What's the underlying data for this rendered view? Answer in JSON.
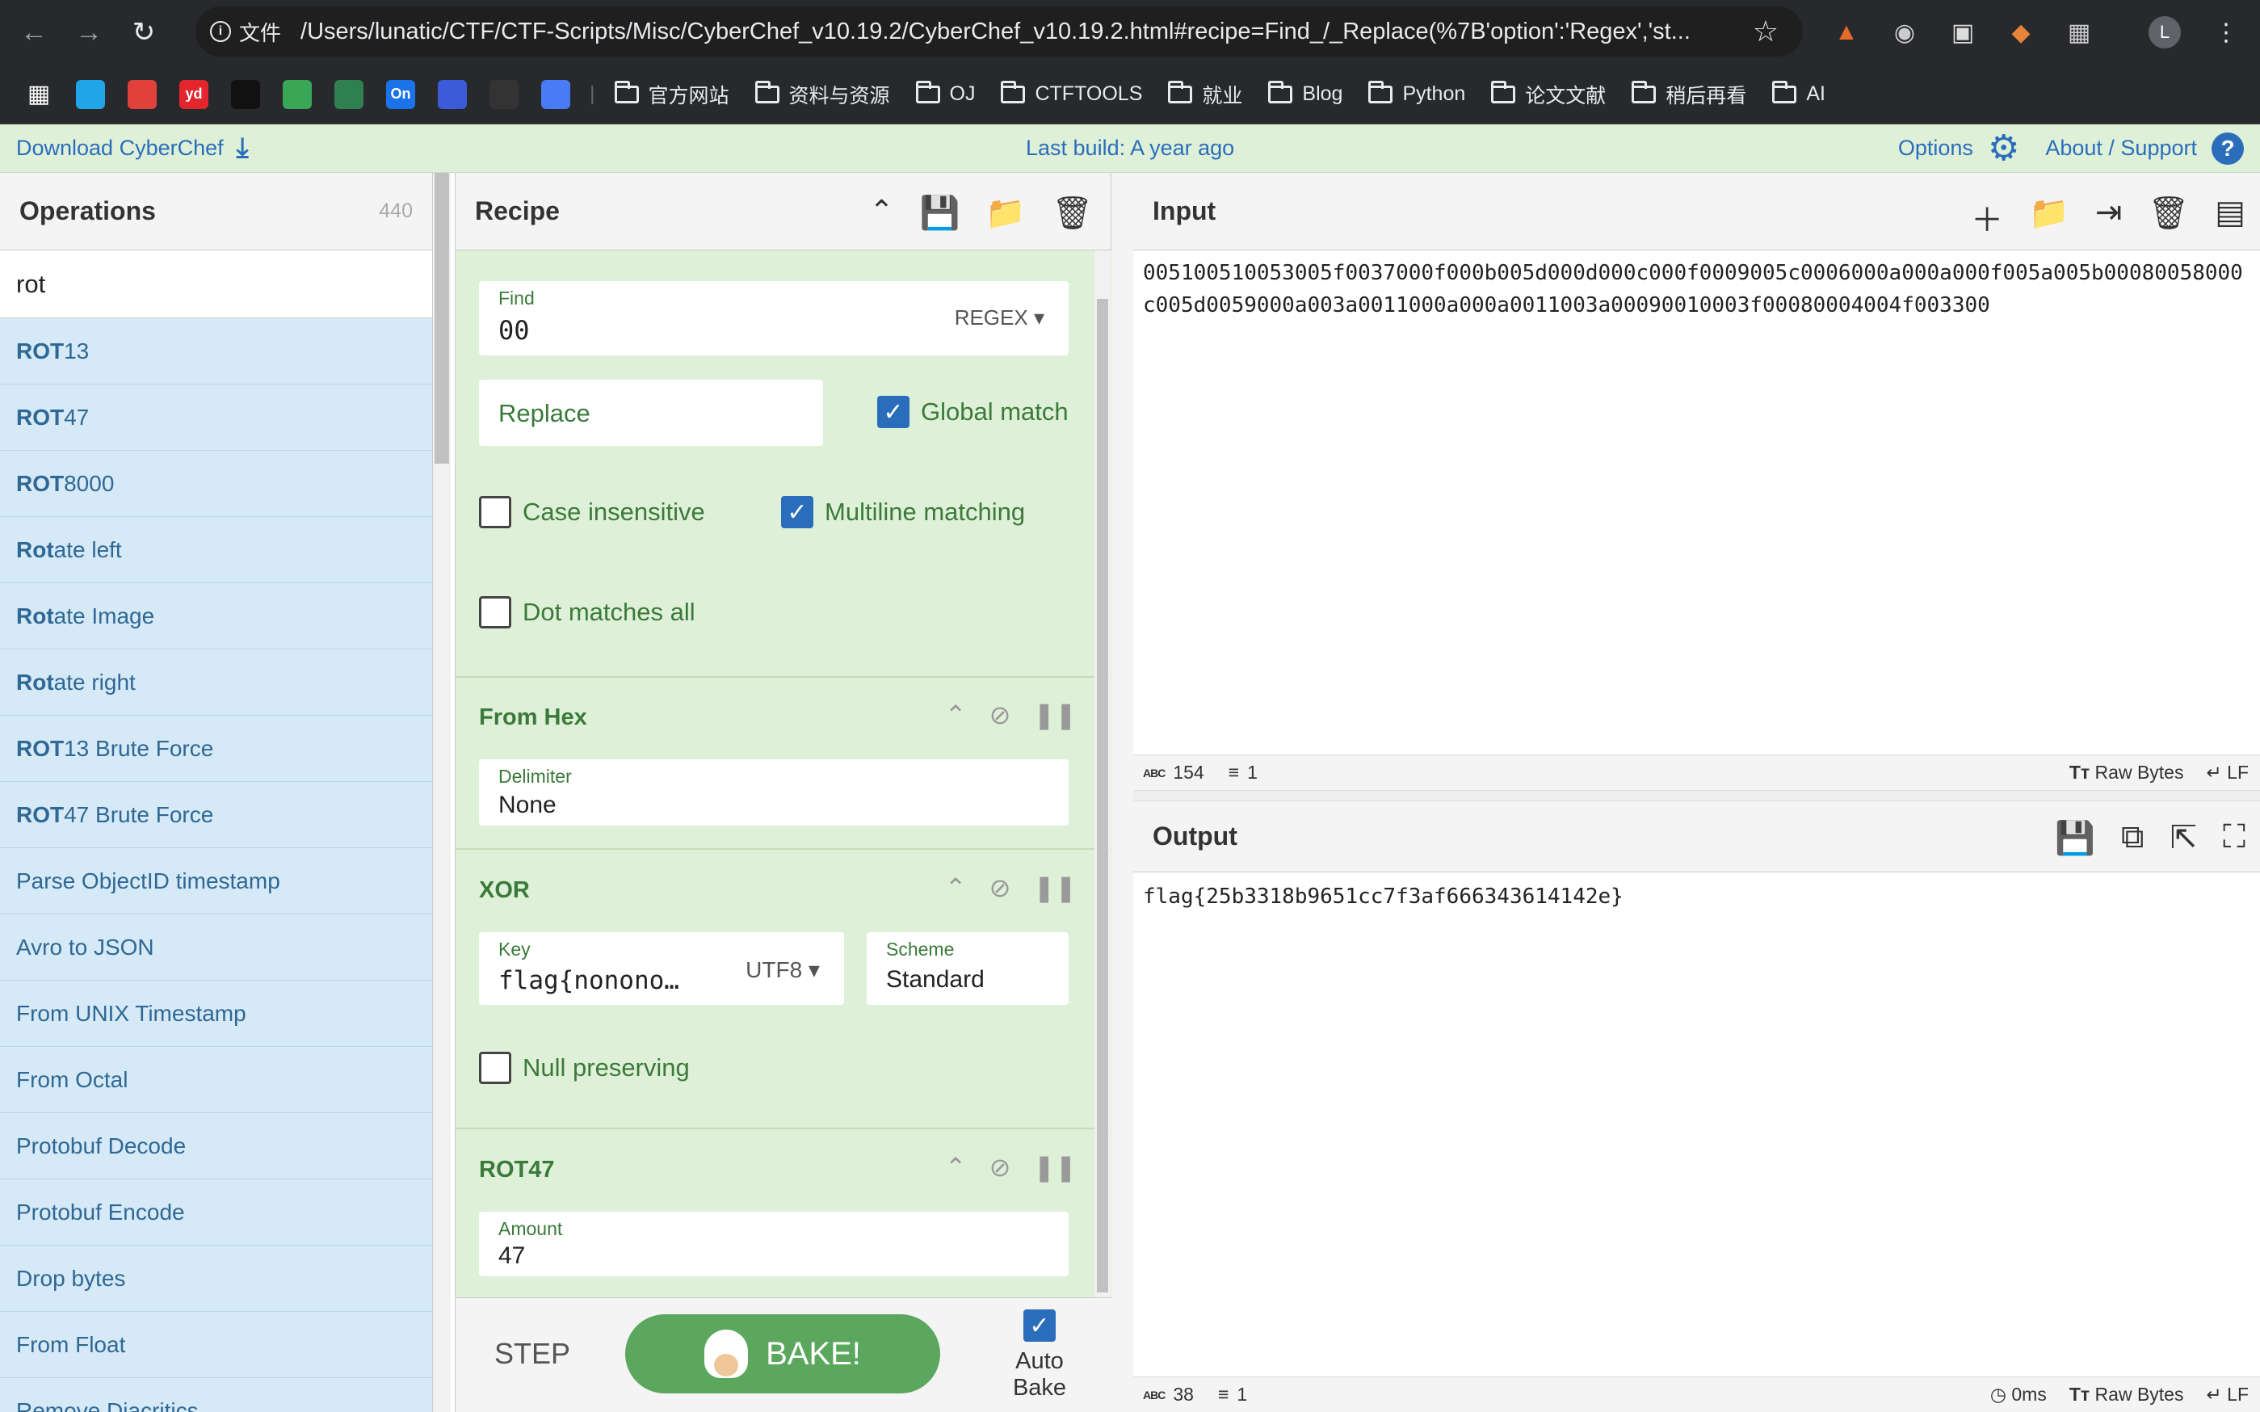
{
  "browser": {
    "address_info": "文件",
    "url": "/Users/lunatic/CTF/CTF-Scripts/Misc/CyberChef_v10.19.2/CyberChef_v10.19.2.html#recipe=Find_/_Replace(%7B'option':'Regex','st...",
    "profile_initial": "L",
    "bookmark_icons": [
      {
        "icon": "apps-grid-icon",
        "text": "",
        "color": "#28292c"
      },
      {
        "icon": "bilibili-icon",
        "text": "",
        "color": "#20a5e8"
      },
      {
        "icon": "bilibili-live-icon",
        "text": "",
        "color": "#e0413a"
      },
      {
        "icon": "youdao-icon",
        "text": "yd",
        "color": "#e3262e"
      },
      {
        "icon": "bookmark-icon-4",
        "text": "",
        "color": "#111111"
      },
      {
        "icon": "bookmark-icon-5",
        "text": "",
        "color": "#3aa757"
      },
      {
        "icon": "bookmark-icon-6",
        "text": "",
        "color": "#2f7f4f"
      },
      {
        "icon": "onshape-icon",
        "text": "On",
        "color": "#1a73e8"
      },
      {
        "icon": "bookmark-icon-8",
        "text": "",
        "color": "#3b5bdb"
      },
      {
        "icon": "openai-icon",
        "text": "",
        "color": "#333333"
      },
      {
        "icon": "gemini-icon",
        "text": "",
        "color": "#4a7bf7"
      }
    ],
    "bookmark_folders": [
      "官方网站",
      "资料与资源",
      "OJ",
      "CTFTOOLS",
      "就业",
      "Blog",
      "Python",
      "论文文献",
      "稍后再看",
      "AI"
    ]
  },
  "banner": {
    "download": "Download CyberChef",
    "last_build": "Last build: A year ago",
    "options": "Options",
    "about": "About / Support",
    "help": "?"
  },
  "operations": {
    "title": "Operations",
    "count": "440",
    "search": "rot",
    "items": [
      {
        "bold": "ROT",
        "rest": "13"
      },
      {
        "bold": "ROT",
        "rest": "47"
      },
      {
        "bold": "ROT",
        "rest": "8000"
      },
      {
        "bold": "Rot",
        "rest": "ate left"
      },
      {
        "bold": "Rot",
        "rest": "ate Image"
      },
      {
        "bold": "Rot",
        "rest": "ate right"
      },
      {
        "bold": "ROT",
        "rest": "13 Brute Force"
      },
      {
        "bold": "ROT",
        "rest": "47 Brute Force"
      },
      {
        "bold": "",
        "rest": "Parse ObjectID timestamp"
      },
      {
        "bold": "",
        "rest": "Avro to JSON"
      },
      {
        "bold": "",
        "rest": "From UNIX Timestamp"
      },
      {
        "bold": "",
        "rest": "From Octal"
      },
      {
        "bold": "",
        "rest": "Protobuf Decode"
      },
      {
        "bold": "",
        "rest": "Protobuf Encode"
      },
      {
        "bold": "",
        "rest": "Drop bytes"
      },
      {
        "bold": "",
        "rest": "From Float"
      },
      {
        "bold": "",
        "rest": "Remove Diacritics"
      }
    ]
  },
  "recipe": {
    "title": "Recipe",
    "find_replace": {
      "find_label": "Find",
      "find_value": "00",
      "find_type": "REGEX",
      "replace_label": "Replace",
      "global_match": {
        "label": "Global match",
        "checked": true
      },
      "case_insensitive": {
        "label": "Case insensitive",
        "checked": false
      },
      "multiline": {
        "label": "Multiline matching",
        "checked": true
      },
      "dot_all": {
        "label": "Dot matches all",
        "checked": false
      }
    },
    "from_hex": {
      "title": "From Hex",
      "delimiter_label": "Delimiter",
      "delimiter_value": "None"
    },
    "xor": {
      "title": "XOR",
      "key_label": "Key",
      "key_value": "flag{nonono…",
      "key_encoding": "UTF8",
      "scheme_label": "Scheme",
      "scheme_value": "Standard",
      "null_preserving": {
        "label": "Null preserving",
        "checked": false
      }
    },
    "rot47": {
      "title": "ROT47",
      "amount_label": "Amount",
      "amount_value": "47"
    },
    "step": "STEP",
    "bake": "BAKE!",
    "auto_bake": {
      "label": "Auto Bake",
      "checked": true
    }
  },
  "input": {
    "title": "Input",
    "text": "005100510053005f0037000f000b005d000d000c000f0009005c0006000a000a000f005a005b00080058000c005d0059000a003a0011000a000a0011003a00090010003f00080004004f003300",
    "length": "154",
    "lines": "1",
    "encoding": "Raw Bytes",
    "eol": "LF"
  },
  "output": {
    "title": "Output",
    "text": "flag{25b3318b9651cc7f3af666343614142e}",
    "length": "38",
    "lines": "1",
    "time": "0ms",
    "encoding": "Raw Bytes",
    "eol": "LF"
  }
}
